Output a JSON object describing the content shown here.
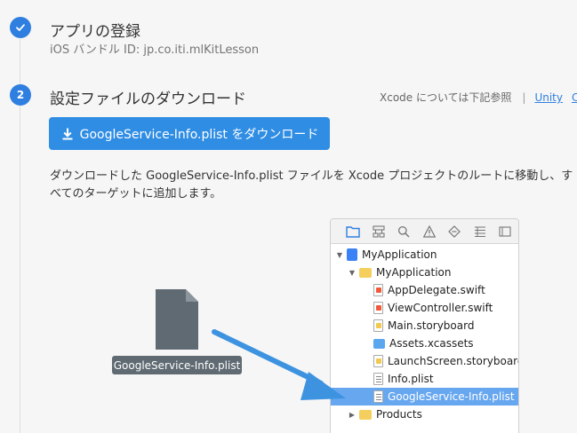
{
  "step1": {
    "number_icon": "check-icon",
    "title": "アプリの登録",
    "bundle_id_line": "iOS バンドル ID: jp.co.iti.mlKitLesson"
  },
  "step2": {
    "number": "2",
    "title": "設定ファイルのダウンロード",
    "helper_text": "Xcode については下記参照",
    "separator": "|",
    "link_unity": "Unity",
    "link_cpp": "C+",
    "download_button_label": "GoogleService-Info.plist をダウンロード",
    "description": "ダウンロードした GoogleService-Info.plist ファイルを Xcode プロジェクトのルートに移動し、すべてのターゲットに追加します。"
  },
  "illustration": {
    "file_label": "GoogleService-Info.plist",
    "xcode": {
      "toolbar_icons": [
        "folder-icon",
        "hierarchy-icon",
        "search-icon",
        "warning-icon",
        "diamond-icon",
        "list-icon",
        "more-icon"
      ],
      "tree": {
        "project": "MyApplication",
        "group": "MyApplication",
        "files": [
          "AppDelegate.swift",
          "ViewController.swift",
          "Main.storyboard",
          "Assets.xcassets",
          "LaunchScreen.storyboard",
          "Info.plist",
          "GoogleService-Info.plist"
        ],
        "products": "Products"
      }
    }
  },
  "colors": {
    "accent": "#2f8de4",
    "selected_row": "#67a7f0",
    "chip": "#5f6a72",
    "arrow": "#3d93e0"
  }
}
